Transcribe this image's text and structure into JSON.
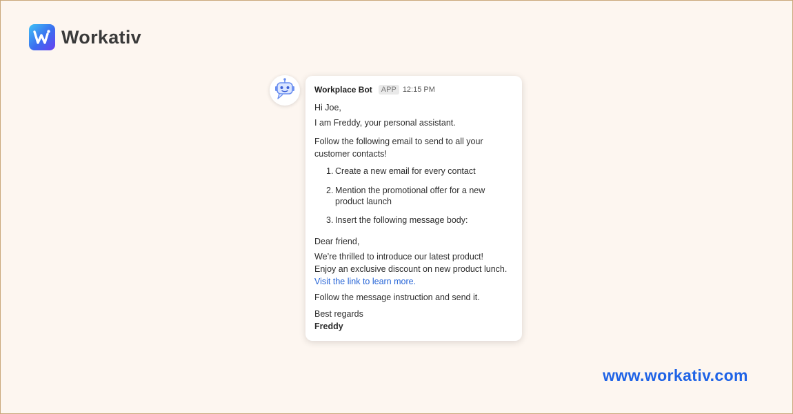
{
  "brand": {
    "name": "Workativ",
    "accent": "#3b6cf0"
  },
  "message": {
    "sender": "Workplace Bot",
    "badge": "APP",
    "time": "12:15 PM",
    "avatar_icon": "robot-icon",
    "greeting": "Hi Joe,",
    "intro": "I am Freddy, your personal assistant.",
    "instruction_line1": "Follow the following email to send to all your",
    "instruction_line2": "customer contacts!",
    "steps": [
      {
        "num": "1.",
        "line1": "Create a new email for every contact",
        "line2": ""
      },
      {
        "num": "2.",
        "line1": "Mention the promotional offer for a new",
        "line2": "product launch"
      },
      {
        "num": "3.",
        "line1": "Insert the following message body:",
        "line2": ""
      }
    ],
    "salutation": "Dear friend,",
    "body_line1": "We’re thrilled to introduce our latest product!",
    "body_line2": "Enjoy an exclusive discount on new product lunch.",
    "link_text": "Visit the link to learn more.",
    "closing_instruction": "Follow the message instruction and send it.",
    "regards": "Best regards",
    "signature": "Freddy"
  },
  "footer": {
    "url": "www.workativ.com"
  }
}
